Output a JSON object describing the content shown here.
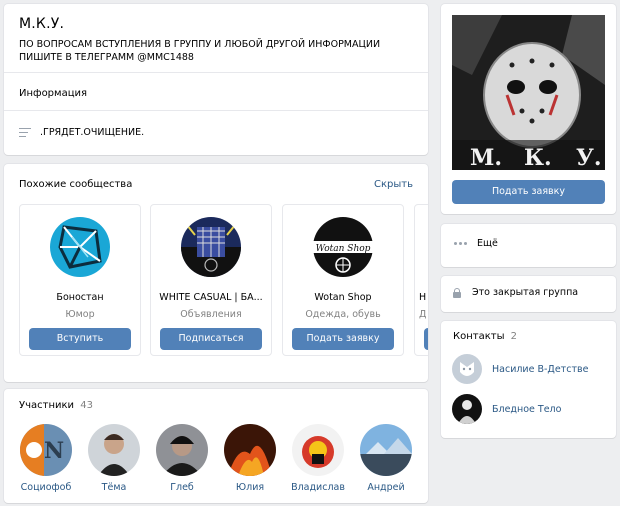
{
  "group": {
    "title": "М.К.У.",
    "status": "ПО ВОПРОСАМ ВСТУПЛЕНИЯ В ГРУППУ И ЛЮБОЙ ДРУГОЙ ИНФОРМАЦИИ ПИШИТЕ В ТЕЛЕГРАММ @MMC1488",
    "info_label": "Информация",
    "description": ".ГРЯДЕТ.ОЧИЩЕНИЕ.",
    "photo_letters": [
      "М.",
      "К.",
      "У."
    ]
  },
  "similar": {
    "title": "Похожие сообщества",
    "hide_label": "Скрыть",
    "items": [
      {
        "name": "Боностан",
        "type": "Юмор",
        "button": "Вступить"
      },
      {
        "name": "WHITE CASUAL | БА...",
        "type": "Объявления",
        "button": "Подписаться"
      },
      {
        "name": "Wotan Shop",
        "type": "Одежда, обувь",
        "button": "Подать заявку"
      },
      {
        "name": "Н",
        "type": "Д",
        "button": ""
      }
    ],
    "wotan_logo_text": "Wotan Shop"
  },
  "members": {
    "title": "Участники",
    "count": "43",
    "items": [
      {
        "name": "Социофоб"
      },
      {
        "name": "Тёма"
      },
      {
        "name": "Глеб"
      },
      {
        "name": "Юлия"
      },
      {
        "name": "Владислав"
      },
      {
        "name": "Андрей"
      }
    ]
  },
  "sidebar": {
    "apply_button": "Подать заявку",
    "more_label": "Ещё",
    "closed_label": "Это закрытая группа",
    "contacts_title": "Контакты",
    "contacts_count": "2",
    "contacts": [
      {
        "name": "Насилие В-Детстве"
      },
      {
        "name": "Бледное Тело"
      }
    ]
  },
  "colors": {
    "accent": "#5181b8",
    "link": "#2a5885",
    "background": "#edeef0"
  }
}
